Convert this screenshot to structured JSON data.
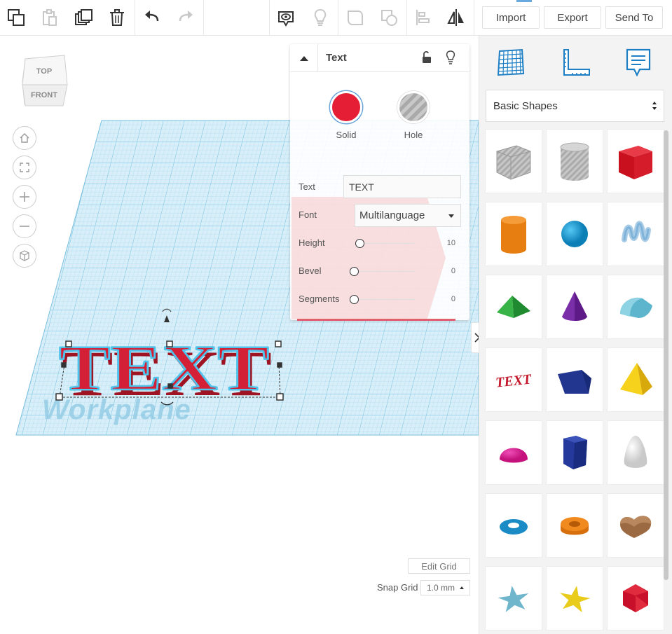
{
  "toolbar": {
    "tools": [
      "copy-icon",
      "paste-icon",
      "duplicate-icon",
      "delete-icon",
      "undo-icon",
      "redo-icon",
      "show-all-icon",
      "light-bulb-icon",
      "group-icon",
      "ungroup-icon",
      "align-icon",
      "mirror-icon"
    ],
    "import_label": "Import",
    "export_label": "Export",
    "send_to_label": "Send To"
  },
  "viewcube": {
    "top_label": "TOP",
    "front_label": "FRONT"
  },
  "viewport": {
    "workplane_label": "Workplane",
    "nav_buttons": [
      "home-view-icon",
      "fit-view-icon",
      "zoom-in-icon",
      "zoom-out-icon",
      "perspective-icon"
    ],
    "edit_grid_label": "Edit Grid",
    "snap_grid_label": "Snap Grid",
    "snap_grid_value": "1.0 mm",
    "text_shape": "TEXT"
  },
  "inspector": {
    "title": "Text",
    "solid_label": "Solid",
    "hole_label": "Hole",
    "solid_color": "#e51e36",
    "props": {
      "text_label": "Text",
      "text_value": "TEXT",
      "font_label": "Font",
      "font_value": "Multilanguage",
      "height_label": "Height",
      "height_value": "10",
      "bevel_label": "Bevel",
      "bevel_value": "0",
      "segments_label": "Segments",
      "segments_value": "0"
    }
  },
  "panel": {
    "tabs": [
      "workplane-grid-icon",
      "ruler-icon",
      "notes-icon"
    ],
    "library_label": "Basic Shapes",
    "shapes": [
      "box-hole",
      "cylinder-hole",
      "box",
      "cylinder",
      "sphere",
      "scribble",
      "roof",
      "cone",
      "round-roof",
      "text",
      "wedge",
      "pyramid",
      "half-sphere",
      "polygon",
      "paraboloid",
      "torus",
      "tube",
      "heart",
      "star",
      "star-yellow",
      "icosahedron"
    ]
  }
}
